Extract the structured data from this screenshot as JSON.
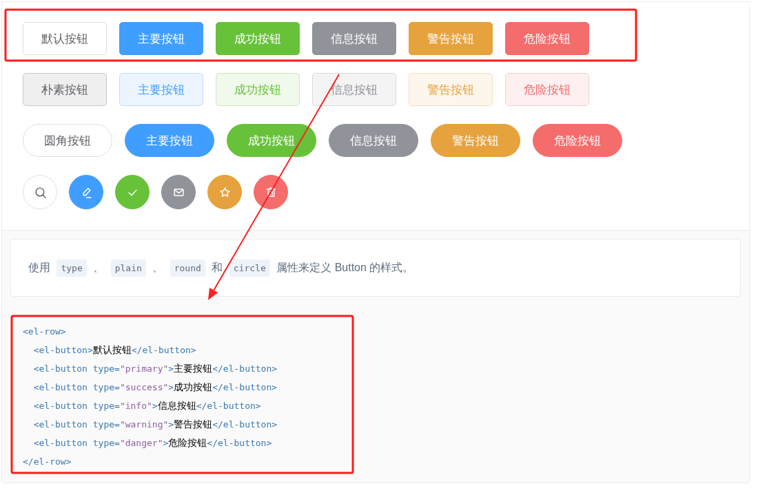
{
  "button_rows": [
    {
      "kind": "normal",
      "buttons": [
        {
          "label": "默认按钮",
          "color": "#ffffff"
        },
        {
          "label": "主要按钮",
          "color": "#409eff"
        },
        {
          "label": "成功按钮",
          "color": "#67c23a"
        },
        {
          "label": "信息按钮",
          "color": "#909399"
        },
        {
          "label": "警告按钮",
          "color": "#e6a23c"
        },
        {
          "label": "危险按钮",
          "color": "#f56c6c"
        }
      ]
    },
    {
      "kind": "plain",
      "buttons": [
        {
          "label": "朴素按钮",
          "color": "#606266"
        },
        {
          "label": "主要按钮",
          "color": "#409eff"
        },
        {
          "label": "成功按钮",
          "color": "#67c23a"
        },
        {
          "label": "信息按钮",
          "color": "#909399"
        },
        {
          "label": "警告按钮",
          "color": "#e6a23c"
        },
        {
          "label": "危险按钮",
          "color": "#f56c6c"
        }
      ]
    },
    {
      "kind": "round",
      "buttons": [
        {
          "label": "圆角按钮",
          "color": "#ffffff"
        },
        {
          "label": "主要按钮",
          "color": "#409eff"
        },
        {
          "label": "成功按钮",
          "color": "#67c23a"
        },
        {
          "label": "信息按钮",
          "color": "#909399"
        },
        {
          "label": "警告按钮",
          "color": "#e6a23c"
        },
        {
          "label": "危险按钮",
          "color": "#f56c6c"
        }
      ]
    },
    {
      "kind": "circle",
      "buttons": [
        {
          "color": "#ffffff"
        },
        {
          "color": "#409eff"
        },
        {
          "color": "#67c23a"
        },
        {
          "color": "#909399"
        },
        {
          "color": "#e6a23c"
        },
        {
          "color": "#f56c6c"
        }
      ]
    }
  ],
  "description": [
    {
      "kind": "text",
      "text": "使用"
    },
    {
      "kind": "code",
      "text": "type"
    },
    {
      "kind": "text",
      "text": "、"
    },
    {
      "kind": "code",
      "text": "plain"
    },
    {
      "kind": "text",
      "text": "、"
    },
    {
      "kind": "code",
      "text": "round"
    },
    {
      "kind": "text",
      "text": "和"
    },
    {
      "kind": "code",
      "text": "circle"
    },
    {
      "kind": "text",
      "text": "属性来定义 Button 的样式。"
    }
  ],
  "code_lines": [
    [
      {
        "kind": "tag",
        "text": "<el-row>"
      }
    ],
    [
      {
        "kind": "tag",
        "text": "  <el-button>"
      },
      {
        "kind": "text",
        "text": "默认按钮"
      },
      {
        "kind": "tag",
        "text": "</el-button>"
      }
    ],
    [
      {
        "kind": "tag",
        "text": "  <el-button type="
      },
      {
        "kind": "string",
        "text": "\"primary\""
      },
      {
        "kind": "tag",
        "text": ">"
      },
      {
        "kind": "text",
        "text": "主要按钮"
      },
      {
        "kind": "tag",
        "text": "</el-button>"
      }
    ],
    [
      {
        "kind": "tag",
        "text": "  <el-button type="
      },
      {
        "kind": "string",
        "text": "\"success\""
      },
      {
        "kind": "tag",
        "text": ">"
      },
      {
        "kind": "text",
        "text": "成功按钮"
      },
      {
        "kind": "tag",
        "text": "</el-button>"
      }
    ],
    [
      {
        "kind": "tag",
        "text": "  <el-button type="
      },
      {
        "kind": "string",
        "text": "\"info\""
      },
      {
        "kind": "tag",
        "text": ">"
      },
      {
        "kind": "text",
        "text": "信息按钮"
      },
      {
        "kind": "tag",
        "text": "</el-button>"
      }
    ],
    [
      {
        "kind": "tag",
        "text": "  <el-button type="
      },
      {
        "kind": "string",
        "text": "\"warning\""
      },
      {
        "kind": "tag",
        "text": ">"
      },
      {
        "kind": "text",
        "text": "警告按钮"
      },
      {
        "kind": "tag",
        "text": "</el-button>"
      }
    ],
    [
      {
        "kind": "tag",
        "text": "  <el-button type="
      },
      {
        "kind": "string",
        "text": "\"danger\""
      },
      {
        "kind": "tag",
        "text": ">"
      },
      {
        "kind": "text",
        "text": "危险按钮"
      },
      {
        "kind": "tag",
        "text": "</el-button>"
      }
    ],
    [
      {
        "kind": "tag",
        "text": "</el-row>"
      }
    ]
  ],
  "annotations": [
    {
      "kind": "box"
    },
    {
      "kind": "box"
    },
    {
      "kind": "arrow"
    }
  ]
}
